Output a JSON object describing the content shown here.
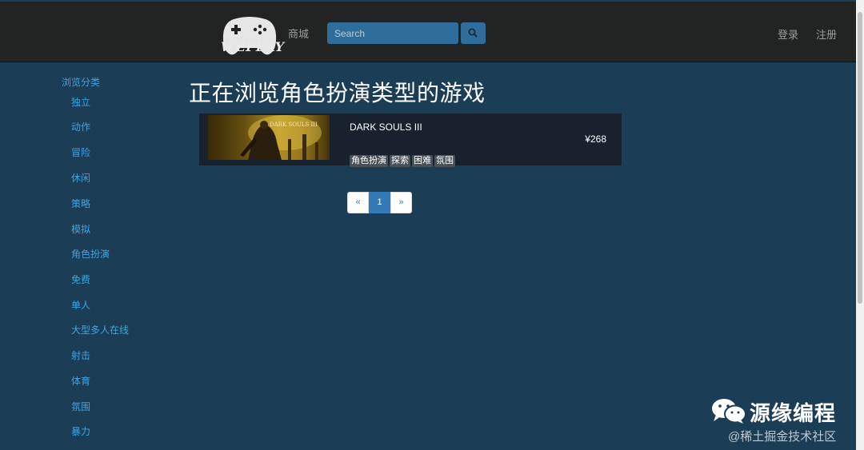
{
  "header": {
    "logo_text": "WEPLAY",
    "store_label": "商城",
    "search": {
      "placeholder": "Search",
      "value": ""
    },
    "login_label": "登录",
    "register_label": "注册"
  },
  "sidebar": {
    "heading": "浏览分类",
    "items": [
      {
        "label": "独立"
      },
      {
        "label": "动作"
      },
      {
        "label": "冒险"
      },
      {
        "label": "休闲"
      },
      {
        "label": "策略"
      },
      {
        "label": "模拟"
      },
      {
        "label": "角色扮演"
      },
      {
        "label": "免费"
      },
      {
        "label": "单人"
      },
      {
        "label": "大型多人在线"
      },
      {
        "label": "射击"
      },
      {
        "label": "体育"
      },
      {
        "label": "氛围"
      },
      {
        "label": "暴力"
      }
    ]
  },
  "main": {
    "title": "正在浏览角色扮演类型的游戏",
    "games": [
      {
        "name": "DARK SOULS III",
        "thumb_text": "DARK SOULS III",
        "price": "¥268",
        "tags": [
          "角色扮演",
          "探索",
          "困难",
          "氛围"
        ]
      }
    ]
  },
  "pagination": {
    "prev": "«",
    "pages": [
      "1"
    ],
    "current": "1",
    "next": "»"
  },
  "watermark": {
    "title": "源缘编程",
    "subtitle": "@稀土掘金技术社区"
  },
  "colors": {
    "background": "#1c3d56",
    "navbar": "#222323",
    "link": "#3fa4e0",
    "search": "#2f6e9a",
    "active_page": "#337ab7"
  }
}
